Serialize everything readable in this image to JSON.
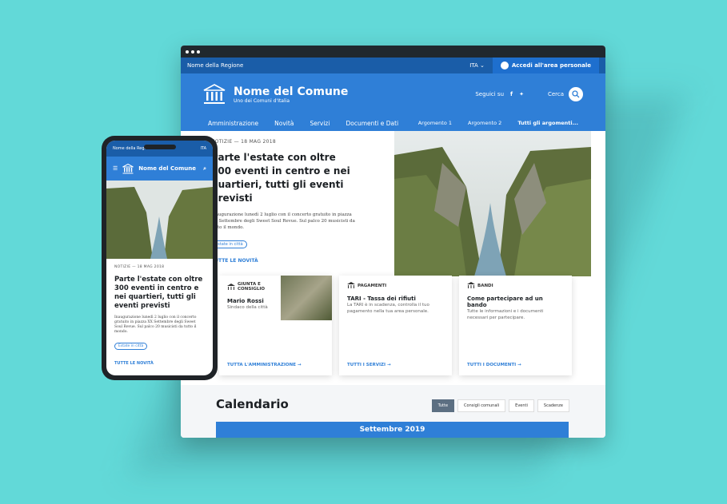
{
  "browser": {
    "slim": {
      "region": "Nome della Regione",
      "lang": "ITA ⌄",
      "login": "Accedi all'area personale"
    },
    "header": {
      "title": "Nome del Comune",
      "subtitle": "Uno dei Comuni d'Italia",
      "social_label": "Seguici su",
      "search_label": "Cerca"
    },
    "nav": {
      "items": [
        "Amministrazione",
        "Novità",
        "Servizi",
        "Documenti e Dati"
      ],
      "args": [
        "Argomento 1",
        "Argomento 2",
        "Tutti gli argomenti..."
      ]
    },
    "hero": {
      "meta": "NOTIZIE — 18 MAG 2018",
      "title": "Parte l'estate con oltre 300 eventi in centro e nei quartieri, tutti gli eventi previsti",
      "text": "Inaugurazione lunedì 2 luglio con il concerto gratuito in piazza XX Settembre degli Sweet Soul Revue. Sul palco 20 musicisti da tutto il mondo.",
      "chip": "Estate in città",
      "all": "TUTTE LE NOVITÀ"
    },
    "cards": [
      {
        "cat": "GIUNTA E CONSIGLIO",
        "title": "Mario Rossi",
        "desc": "Sindaco della città",
        "link": "TUTTA L'AMMINISTRAZIONE →"
      },
      {
        "cat": "PAGAMENTI",
        "title": "TARI - Tassa dei rifiuti",
        "desc": "La TARI è in scadenza, controlla il tuo pagamento nella tua area personale.",
        "link": "TUTTI I SERVIZI →"
      },
      {
        "cat": "BANDI",
        "title": "Come partecipare ad un bando",
        "desc": "Tutte le informazioni e i documenti necessari per partecipare.",
        "link": "TUTTI I DOCUMENTI →"
      }
    ],
    "calendar": {
      "title": "Calendario",
      "filters": [
        "Tutte",
        "Consigli comunali",
        "Eventi",
        "Scadenze"
      ],
      "month": "Settembre 2019"
    }
  },
  "phone": {
    "region": "Nome della Regione",
    "lang": "ITA",
    "title": "Nome del Comune",
    "meta": "NOTIZIE — 18 MAG 2018",
    "headline": "Parte l'estate con oltre 300 eventi in centro e nei quartieri, tutti gli eventi previsti",
    "text": "Inaugurazione lunedì 2 luglio con il concerto gratuito in piazza XX Settembre degli Sweet Soul Revue. Sul palco 20 musicisti da tutto il mondo.",
    "chip": "Estate in città",
    "all": "TUTTE LE NOVITÀ"
  },
  "colors": {
    "bg": "#62d9d8",
    "primary": "#2f7fd7",
    "dark": "#1a5da8"
  }
}
